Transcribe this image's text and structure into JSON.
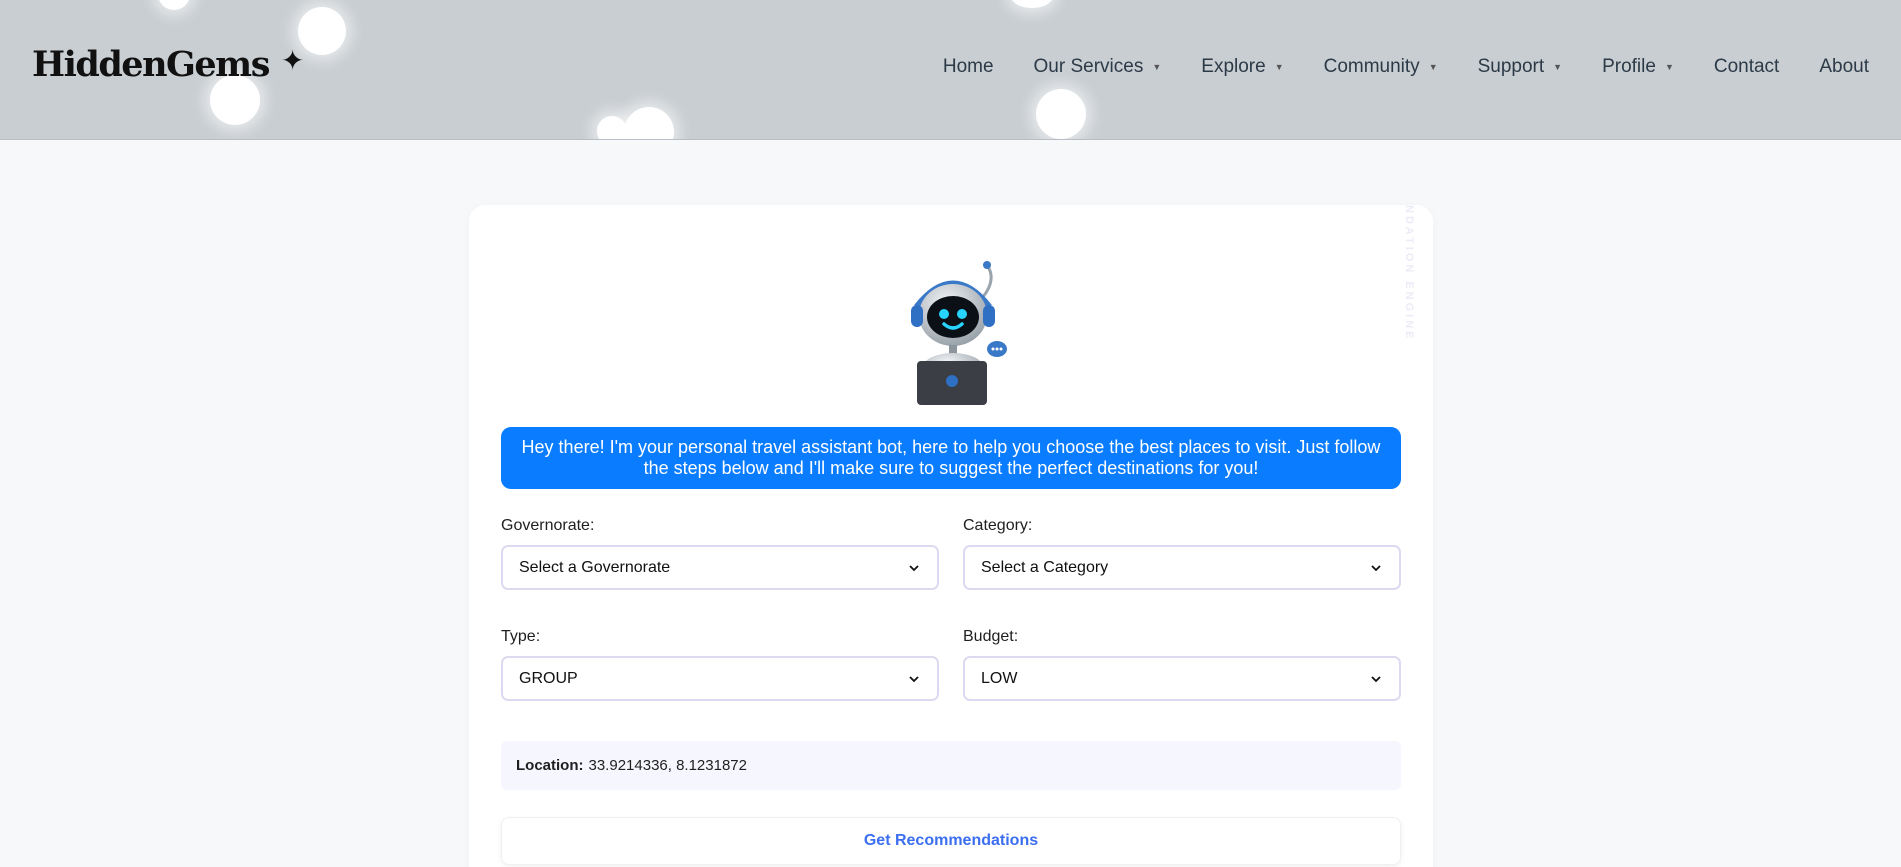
{
  "header": {
    "logo": "HiddenGems",
    "logo_icon": "sparkle-icon",
    "nav": [
      {
        "label": "Home",
        "dropdown": false
      },
      {
        "label": "Our Services",
        "dropdown": true
      },
      {
        "label": "Explore",
        "dropdown": true
      },
      {
        "label": "Community",
        "dropdown": true
      },
      {
        "label": "Support",
        "dropdown": true
      },
      {
        "label": "Profile",
        "dropdown": true
      },
      {
        "label": "Contact",
        "dropdown": false
      },
      {
        "label": "About",
        "dropdown": false
      }
    ]
  },
  "card": {
    "watermark": "NDATION ENGINE",
    "bot_message": "Hey there! I'm your personal travel assistant bot, here to help you choose the best places to visit. Just follow the steps below and I'll make sure to suggest the perfect destinations for you!",
    "fields": {
      "governorate": {
        "label": "Governorate:",
        "value": "Select a Governorate"
      },
      "category": {
        "label": "Category:",
        "value": "Select a Category"
      },
      "type": {
        "label": "Type:",
        "value": "GROUP"
      },
      "budget": {
        "label": "Budget:",
        "value": "LOW"
      }
    },
    "location": {
      "label": "Location:",
      "value": "33.9214336, 8.1231872"
    },
    "button_label": "Get Recommendations"
  },
  "colors": {
    "header_bg": "#c9ced2",
    "accent_blue": "#0a7cff",
    "button_text": "#3b6ff0"
  }
}
